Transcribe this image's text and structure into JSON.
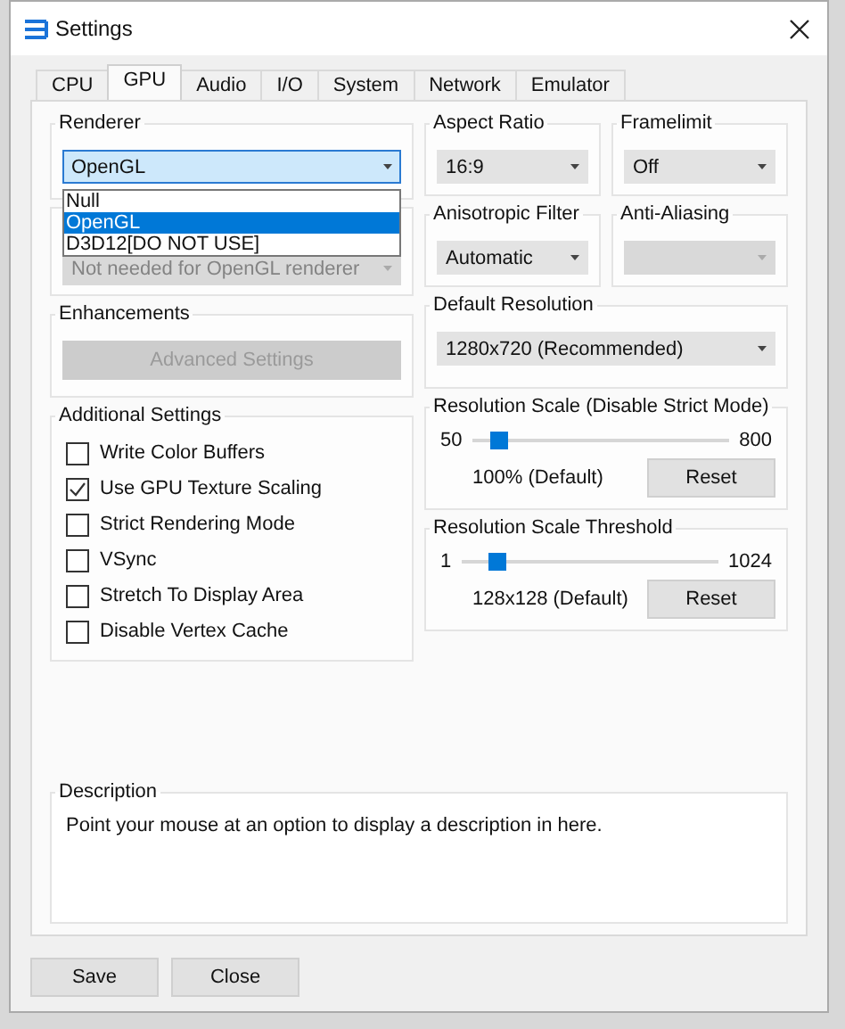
{
  "window": {
    "title": "Settings"
  },
  "tabs": [
    {
      "label": "CPU",
      "selected": false
    },
    {
      "label": "GPU",
      "selected": true
    },
    {
      "label": "Audio",
      "selected": false
    },
    {
      "label": "I/O",
      "selected": false
    },
    {
      "label": "System",
      "selected": false
    },
    {
      "label": "Network",
      "selected": false
    },
    {
      "label": "Emulator",
      "selected": false
    }
  ],
  "renderer": {
    "title": "Renderer",
    "value": "OpenGL",
    "open": true,
    "options": [
      {
        "label": "Null",
        "selected": false
      },
      {
        "label": "OpenGL",
        "selected": true
      },
      {
        "label": "D3D12[DO NOT USE]",
        "selected": false
      }
    ]
  },
  "graphics_device": {
    "value": "Not needed for OpenGL renderer",
    "disabled": true
  },
  "aspect_ratio": {
    "title": "Aspect Ratio",
    "value": "16:9",
    "disabled": false
  },
  "framelimit": {
    "title": "Framelimit",
    "value": "Off",
    "disabled": false
  },
  "anisotropic_filter": {
    "title": "Anisotropic Filter",
    "value": "Automatic",
    "disabled": false
  },
  "anti_aliasing": {
    "title": "Anti-Aliasing",
    "disabled": true
  },
  "enhancements": {
    "title": "Enhancements",
    "button": {
      "label": "Advanced Settings",
      "disabled": true
    }
  },
  "default_resolution": {
    "title": "Default Resolution",
    "value": "1280x720 (Recommended)",
    "disabled": false
  },
  "additional_settings": {
    "title": "Additional Settings",
    "options": [
      {
        "label": "Write Color Buffers",
        "checked": false
      },
      {
        "label": "Use GPU Texture Scaling",
        "checked": true
      },
      {
        "label": "Strict Rendering Mode",
        "checked": false
      },
      {
        "label": "VSync",
        "checked": false
      },
      {
        "label": "Stretch To Display Area",
        "checked": false
      },
      {
        "label": "Disable Vertex Cache",
        "checked": false
      }
    ]
  },
  "resolution_scale": {
    "title": "Resolution Scale (Disable Strict Mode)",
    "min": "50",
    "max": "800",
    "level": 0.1,
    "reading": "100% (Default)",
    "button": "Reset"
  },
  "resolution_scale_threshold": {
    "title": "Resolution Scale Threshold",
    "min": "1",
    "max": "1024",
    "level": 0.14,
    "reading": "128x128 (Default)",
    "button": "Reset"
  },
  "description": {
    "title": "Description",
    "text": "Point your mouse at an option to display a description in here."
  },
  "buttons": [
    "Save",
    "Close"
  ]
}
